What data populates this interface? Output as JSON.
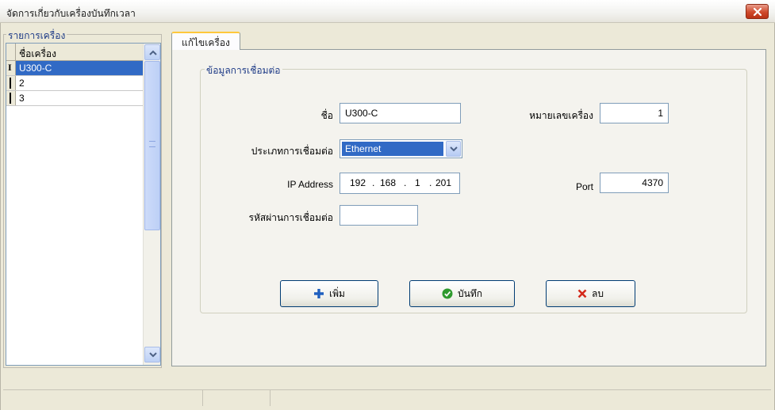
{
  "window": {
    "title": "จัดการเกี่ยวกับเครื่องบันทึกเวลา"
  },
  "device_list": {
    "group_label": "รายการเครื่อง",
    "column_header": "ชื่อเครื่อง",
    "rows": [
      {
        "name": "U300-C",
        "selected": true
      },
      {
        "name": "2",
        "selected": false
      },
      {
        "name": "3",
        "selected": false
      }
    ]
  },
  "tab": {
    "label": "แก้ไขเครื่อง"
  },
  "connection": {
    "group_label": "ข้อมูลการเชื่อมต่อ",
    "name_label": "ชื่อ",
    "name_value": "U300-C",
    "machine_no_label": "หมายเลขเครื่อง",
    "machine_no_value": "1",
    "conn_type_label": "ประเภทการเชื่อมต่อ",
    "conn_type_value": "Ethernet",
    "ip_label": "IP Address",
    "ip": [
      "192",
      "168",
      "1",
      "201"
    ],
    "port_label": "Port",
    "port_value": "4370",
    "password_label": "รหัสผ่านการเชื่อมต่อ",
    "password_value": ""
  },
  "buttons": {
    "add": "เพิ่ม",
    "save": "บันทึก",
    "delete": "ลบ"
  },
  "colors": {
    "selection": "#316ac5",
    "add_icon": "#1f5fbf",
    "save_icon": "#2e9a2e",
    "delete_icon": "#d42a1c"
  }
}
